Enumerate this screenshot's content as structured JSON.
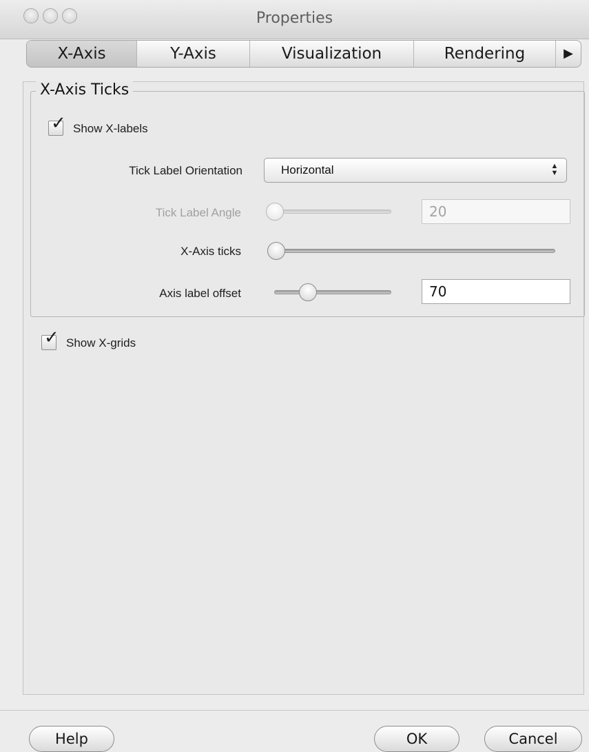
{
  "window": {
    "title": "Properties"
  },
  "tabs": [
    {
      "label": "X-Axis",
      "active": true
    },
    {
      "label": "Y-Axis",
      "active": false
    },
    {
      "label": "Visualization",
      "active": false
    },
    {
      "label": "Rendering",
      "active": false
    },
    {
      "label": "▶",
      "active": false
    }
  ],
  "group": {
    "legend": "X-Axis Ticks",
    "show_labels": {
      "label": "Show X-labels",
      "checked": true
    },
    "orientation": {
      "label": "Tick Label Orientation",
      "value": "Horizontal"
    },
    "angle": {
      "label": "Tick Label Angle",
      "value": "20",
      "slider_fraction": 0.0,
      "enabled": false
    },
    "ticks": {
      "label": "X-Axis ticks",
      "slider_fraction": 0.0
    },
    "offset": {
      "label": "Axis label offset",
      "value": "70",
      "slider_fraction": 0.3
    }
  },
  "show_grids": {
    "label": "Show X-grids",
    "checked": true
  },
  "buttons": {
    "help": "Help",
    "ok": "OK",
    "cancel": "Cancel"
  }
}
